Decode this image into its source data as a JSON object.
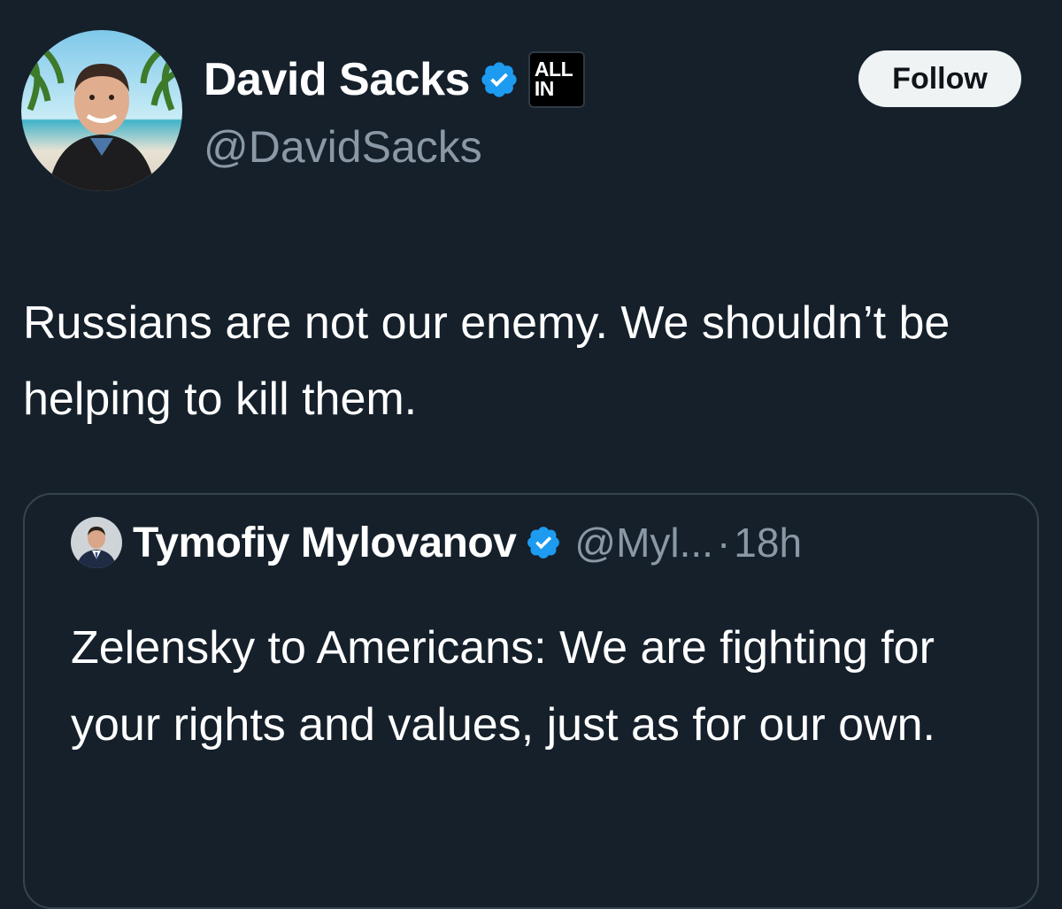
{
  "tweet": {
    "author": {
      "display_name": "David Sacks",
      "handle": "@DavidSacks",
      "verified_icon": "verified-badge-icon",
      "org_badge": {
        "line1": "ALL",
        "line2": "IN"
      }
    },
    "follow_label": "Follow",
    "text": "Russians are not our enemy. We shouldn’t be helping to kill them."
  },
  "quoted_tweet": {
    "author": {
      "display_name": "Tymofiy Mylovanov",
      "handle": "@Myl...",
      "verified_icon": "verified-badge-icon"
    },
    "separator": "·",
    "time": "18h",
    "text": "Zelensky to Americans: We are fighting for your rights and values, just as for our own."
  },
  "colors": {
    "background": "#15202b",
    "verified_blue": "#1d9bf0",
    "secondary_text": "#8b98a5",
    "follow_button_bg": "#eff3f4",
    "card_border": "#38444d"
  }
}
